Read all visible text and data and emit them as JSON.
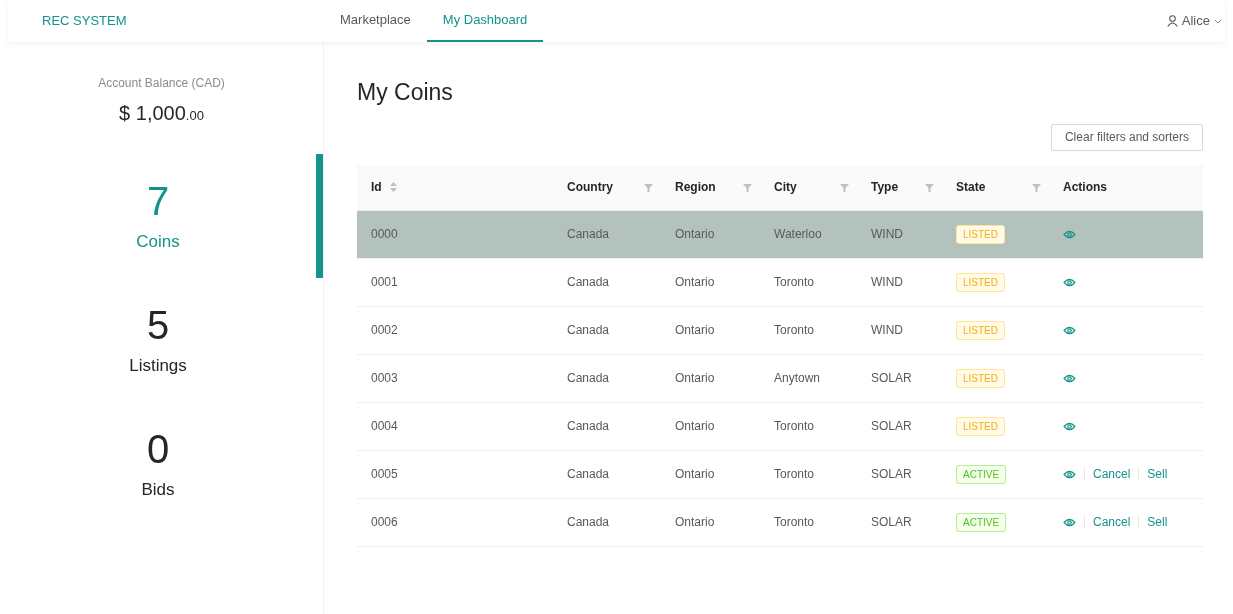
{
  "header": {
    "brand": "REC SYSTEM",
    "nav": [
      {
        "label": "Marketplace",
        "selected": false
      },
      {
        "label": "My Dashboard",
        "selected": true
      }
    ],
    "user": "Alice"
  },
  "sidebar": {
    "balance_label": "Account Balance (CAD)",
    "balance_currency": "$",
    "balance_whole": "1,000",
    "balance_cents": ".00",
    "stats": [
      {
        "value": "7",
        "label": "Coins",
        "selected": true
      },
      {
        "value": "5",
        "label": "Listings",
        "selected": false
      },
      {
        "value": "0",
        "label": "Bids",
        "selected": false
      }
    ]
  },
  "main": {
    "title": "My Coins",
    "clear_button": "Clear filters and sorters",
    "table": {
      "columns": [
        {
          "label": "Id",
          "kind": "sort"
        },
        {
          "label": "Country",
          "kind": "filter"
        },
        {
          "label": "Region",
          "kind": "filter"
        },
        {
          "label": "City",
          "kind": "filter"
        },
        {
          "label": "Type",
          "kind": "filter"
        },
        {
          "label": "State",
          "kind": "filter"
        },
        {
          "label": "Actions",
          "kind": "plain"
        }
      ],
      "rows": [
        {
          "id": "0000",
          "country": "Canada",
          "region": "Ontario",
          "city": "Waterloo",
          "type": "WIND",
          "state": {
            "label": "LISTED",
            "kind": "listed"
          },
          "actions": [],
          "selected": true
        },
        {
          "id": "0001",
          "country": "Canada",
          "region": "Ontario",
          "city": "Toronto",
          "type": "WIND",
          "state": {
            "label": "LISTED",
            "kind": "listed"
          },
          "actions": [],
          "selected": false
        },
        {
          "id": "0002",
          "country": "Canada",
          "region": "Ontario",
          "city": "Toronto",
          "type": "WIND",
          "state": {
            "label": "LISTED",
            "kind": "listed"
          },
          "actions": [],
          "selected": false
        },
        {
          "id": "0003",
          "country": "Canada",
          "region": "Ontario",
          "city": "Anytown",
          "type": "SOLAR",
          "state": {
            "label": "LISTED",
            "kind": "listed"
          },
          "actions": [],
          "selected": false
        },
        {
          "id": "0004",
          "country": "Canada",
          "region": "Ontario",
          "city": "Toronto",
          "type": "SOLAR",
          "state": {
            "label": "LISTED",
            "kind": "listed"
          },
          "actions": [],
          "selected": false
        },
        {
          "id": "0005",
          "country": "Canada",
          "region": "Ontario",
          "city": "Toronto",
          "type": "SOLAR",
          "state": {
            "label": "ACTIVE",
            "kind": "active"
          },
          "actions": [
            "Cancel",
            "Sell"
          ],
          "selected": false
        },
        {
          "id": "0006",
          "country": "Canada",
          "region": "Ontario",
          "city": "Toronto",
          "type": "SOLAR",
          "state": {
            "label": "ACTIVE",
            "kind": "active"
          },
          "actions": [
            "Cancel",
            "Sell"
          ],
          "selected": false
        }
      ]
    }
  }
}
